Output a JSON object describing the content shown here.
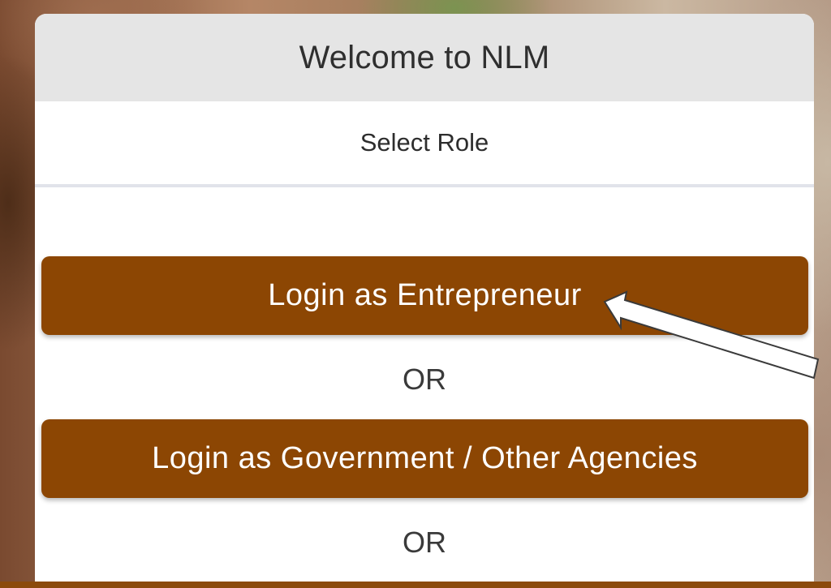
{
  "dialog": {
    "title": "Welcome to NLM",
    "subtitle": "Select Role"
  },
  "buttons": {
    "entrepreneur": "Login as Entrepreneur",
    "government": "Login as Government / Other Agencies"
  },
  "separators": [
    "OR",
    "OR"
  ],
  "colors": {
    "button_bg": "#8c4603",
    "header_bg": "#e5e5e5",
    "annotation_arrow": "#ffffff"
  },
  "annotation": {
    "icon": "pointer-arrow-icon"
  }
}
